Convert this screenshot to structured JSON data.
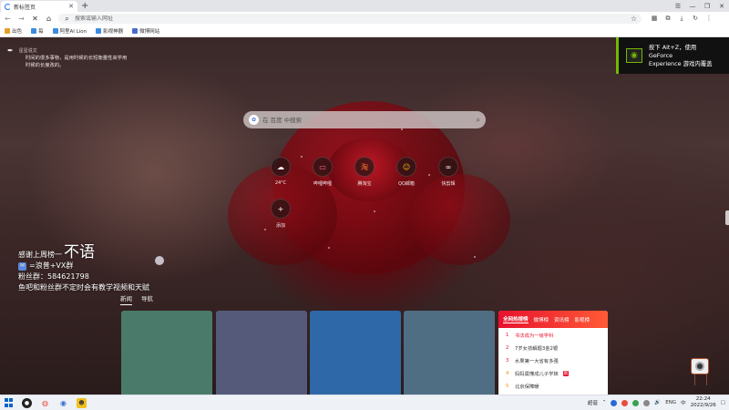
{
  "browser": {
    "tab_title": "新标签页",
    "omnibox_placeholder": "搜索或输入网址",
    "bookmarks": [
      {
        "label": "出色",
        "color": "#e0a030"
      },
      {
        "label": "每",
        "color": "#3b8ce0"
      },
      {
        "label": "阿里AI Lion",
        "color": "#3b8ce0"
      },
      {
        "label": "影视神器",
        "color": "#3b8ce0"
      },
      {
        "label": "微博网站",
        "color": "#4a6ad0"
      }
    ]
  },
  "notice": {
    "header": "星星说文",
    "body_line1": "时间的很多事物，是用时候的长短衡量性来学用",
    "body_line2": "时候的长度改的。"
  },
  "nvidia": {
    "line1": "按下 Alt+Z，使用 GeForce",
    "line2": "Experience 游戏内覆盖"
  },
  "search": {
    "engine_icon": "paw-icon",
    "placeholder": "在 百度 中搜索"
  },
  "quick_links": [
    {
      "label": "24°C",
      "icon": "weather-icon"
    },
    {
      "label": "哔哩哔哩",
      "icon": "bilibili-icon"
    },
    {
      "label": "腾淘宝",
      "icon": "taobao-icon"
    },
    {
      "label": "QQ邮箱",
      "icon": "qq-icon"
    },
    {
      "label": "快剪辑",
      "icon": "clip-icon"
    },
    {
      "label": "添加",
      "icon": "plus-icon"
    }
  ],
  "promo": {
    "line1_prefix": "感谢上周榜一",
    "line1_big": "不语",
    "line2": "=浪普+VX群",
    "line3": "粉丝群：584621798",
    "line4": "鱼吧和粉丝群不定时会有教学视频和天赋"
  },
  "nav_tabs": [
    {
      "label": "新闻",
      "active": true
    },
    {
      "label": "导航",
      "active": false
    }
  ],
  "cards": [
    {
      "color": "#4a7a6a"
    },
    {
      "color": "#555a7a"
    },
    {
      "color": "#2f68a8"
    },
    {
      "color": "#4f6e84"
    }
  ],
  "hot_list": {
    "tabs": [
      "全网热搜榜",
      "微博榜",
      "资讯榜",
      "影视榜"
    ],
    "items": [
      {
        "rank": "1",
        "text": "书法成为一级学科",
        "tag": ""
      },
      {
        "rank": "2",
        "text": "7岁女孩解题3金2银",
        "tag": ""
      },
      {
        "rank": "3",
        "text": "水果第一大省有多强",
        "tag": ""
      },
      {
        "rank": "4",
        "text": "妈妈需懂成儿子学妹",
        "tag": "新"
      },
      {
        "rank": "5",
        "text": "北京保障暖",
        "tag": ""
      }
    ]
  },
  "taskbar": {
    "tray_text": "超谐",
    "lang": "ENG",
    "time": "22:24",
    "date": "2022/9/26"
  }
}
